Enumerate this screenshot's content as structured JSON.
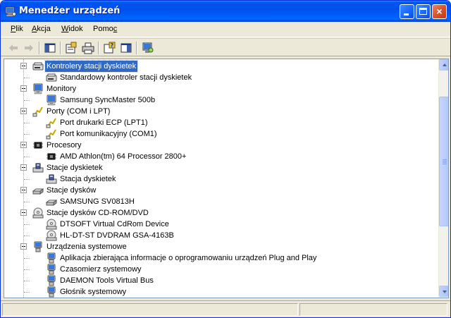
{
  "window": {
    "title": "Menedżer urządzeń",
    "icon": "computer-management-icon"
  },
  "titlebar_buttons": {
    "close_glyph": "×"
  },
  "menu": [
    {
      "label": "Plik",
      "accel": "P",
      "rest": "lik"
    },
    {
      "label": "Akcja",
      "accel": "A",
      "rest": "kcja"
    },
    {
      "label": "Widok",
      "accel": "W",
      "rest": "idok"
    },
    {
      "label": "Pomoc",
      "pre": "Pomo",
      "accel": "c"
    }
  ],
  "toolbar": [
    {
      "icon": "back-arrow-icon",
      "enabled": false
    },
    {
      "icon": "forward-arrow-icon",
      "enabled": false
    },
    {
      "icon": "show-hide-console-tree-icon",
      "enabled": true
    },
    {
      "icon": "properties-icon",
      "enabled": true
    },
    {
      "icon": "print-icon",
      "enabled": true
    },
    {
      "icon": "help-icon",
      "enabled": true
    },
    {
      "icon": "show-action-pane-icon",
      "enabled": true
    },
    {
      "icon": "scan-hardware-changes-icon",
      "enabled": true
    }
  ],
  "tree": {
    "items": [
      {
        "level": 0,
        "label": "Kontrolery stacji dyskietek",
        "icon": "floppy-controller-icon",
        "expanded": true,
        "selected": true
      },
      {
        "level": 1,
        "label": "Standardowy kontroler stacji dyskietek",
        "icon": "floppy-controller-icon"
      },
      {
        "level": 0,
        "label": "Monitory",
        "icon": "monitor-icon",
        "expanded": true
      },
      {
        "level": 1,
        "label": "Samsung SyncMaster 500b",
        "icon": "monitor-icon"
      },
      {
        "level": 0,
        "label": "Porty (COM i LPT)",
        "icon": "port-icon",
        "expanded": true
      },
      {
        "level": 1,
        "label": "Port drukarki ECP (LPT1)",
        "icon": "port-icon"
      },
      {
        "level": 1,
        "label": "Port komunikacyjny (COM1)",
        "icon": "port-icon"
      },
      {
        "level": 0,
        "label": "Procesory",
        "icon": "processor-icon",
        "expanded": true
      },
      {
        "level": 1,
        "label": "AMD Athlon(tm) 64 Processor 2800+",
        "icon": "processor-icon"
      },
      {
        "level": 0,
        "label": "Stacje dyskietek",
        "icon": "floppy-drive-icon",
        "expanded": true
      },
      {
        "level": 1,
        "label": "Stacja dyskietek",
        "icon": "floppy-drive-icon"
      },
      {
        "level": 0,
        "label": "Stacje dysków",
        "icon": "hard-disk-icon",
        "expanded": true
      },
      {
        "level": 1,
        "label": "SAMSUNG SV0813H",
        "icon": "hard-disk-icon"
      },
      {
        "level": 0,
        "label": "Stacje dysków CD-ROM/DVD",
        "icon": "cdrom-icon",
        "expanded": true
      },
      {
        "level": 1,
        "label": "DTSOFT Virtual CdRom Device",
        "icon": "cdrom-icon"
      },
      {
        "level": 1,
        "label": "HL-DT-ST DVDRAM GSA-4163B",
        "icon": "cdrom-icon"
      },
      {
        "level": 0,
        "label": "Urządzenia systemowe",
        "icon": "system-device-icon",
        "expanded": true
      },
      {
        "level": 1,
        "label": "Aplikacja zbierająca informacje o oprogramowaniu urządzeń Plug and Play",
        "icon": "system-device-icon"
      },
      {
        "level": 1,
        "label": "Czasomierz systemowy",
        "icon": "system-device-icon"
      },
      {
        "level": 1,
        "label": "DAEMON Tools Virtual Bus",
        "icon": "system-device-icon"
      },
      {
        "level": 1,
        "label": "Głośnik systemowy",
        "icon": "system-device-icon"
      }
    ]
  },
  "scrollbar": {
    "position": 0.3,
    "visible_fraction": 0.6
  },
  "colors": {
    "titlebar": "#0053ee",
    "selection": "#316ac5",
    "window_bg": "#ece9d8"
  }
}
